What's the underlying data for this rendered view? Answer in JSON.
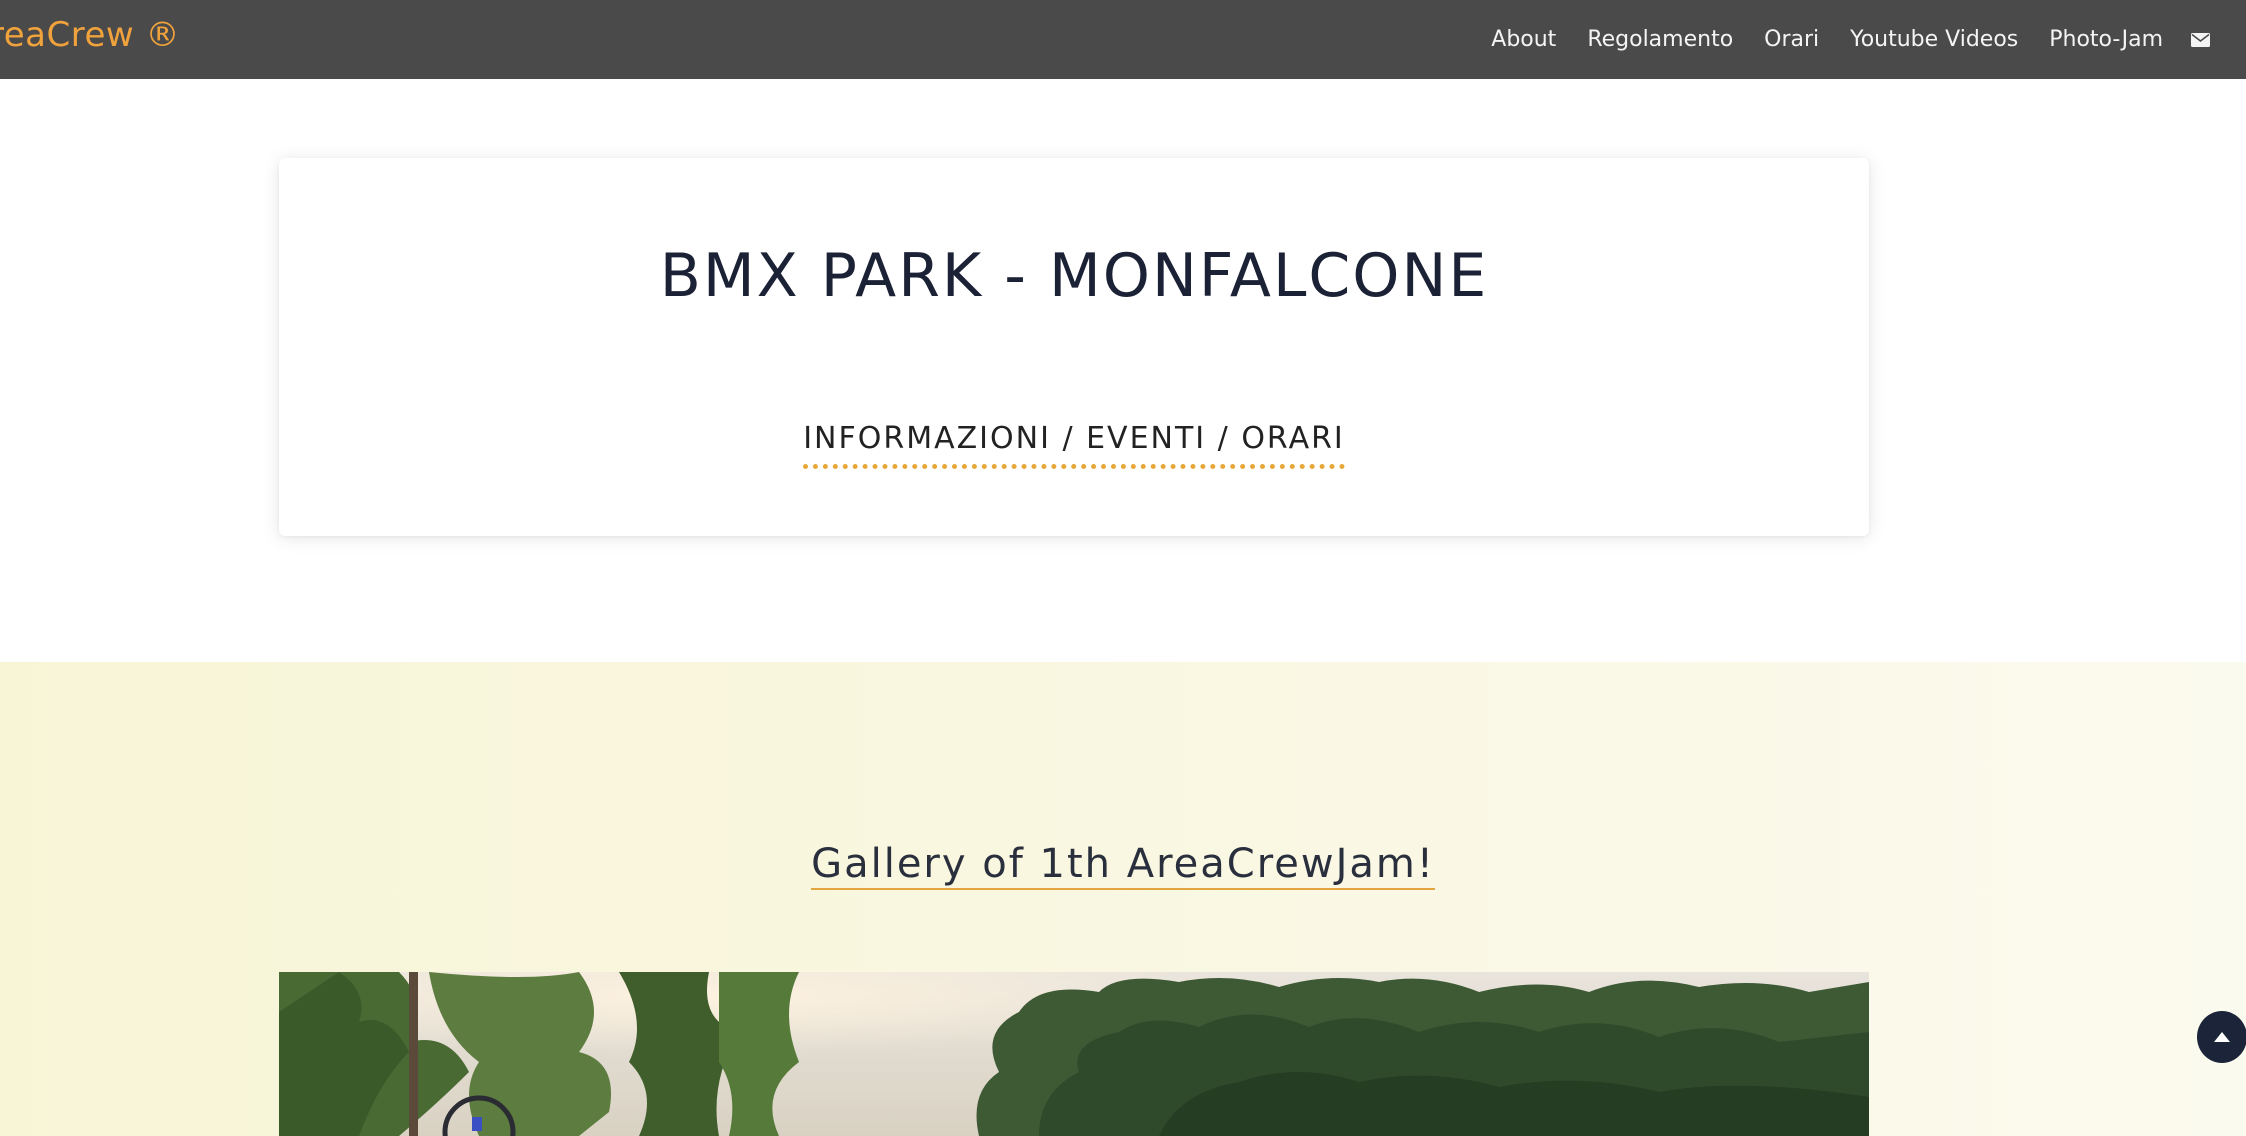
{
  "navbar": {
    "brand": "reaCrew ®",
    "links": [
      "About",
      "Regolamento",
      "Orari",
      "Youtube Videos",
      "Photo-Jam"
    ],
    "mail_icon": "envelope-icon"
  },
  "header": {
    "title": "BMX PARK - MONFALCONE",
    "subtitle": "INFORMAZIONI / EVENTI / ORARI"
  },
  "gallery": {
    "heading": "Gallery of 1th AreaCrewJam!"
  },
  "scroll_top": {
    "icon": "arrow-up-icon"
  },
  "colors": {
    "navbar_bg": "#4a4a4a",
    "brand": "#f0a23c",
    "accent": "#e7a83a",
    "title": "#1b2236",
    "gallery_bg": "#f8f5d7",
    "scroll_button": "#1b2438"
  }
}
